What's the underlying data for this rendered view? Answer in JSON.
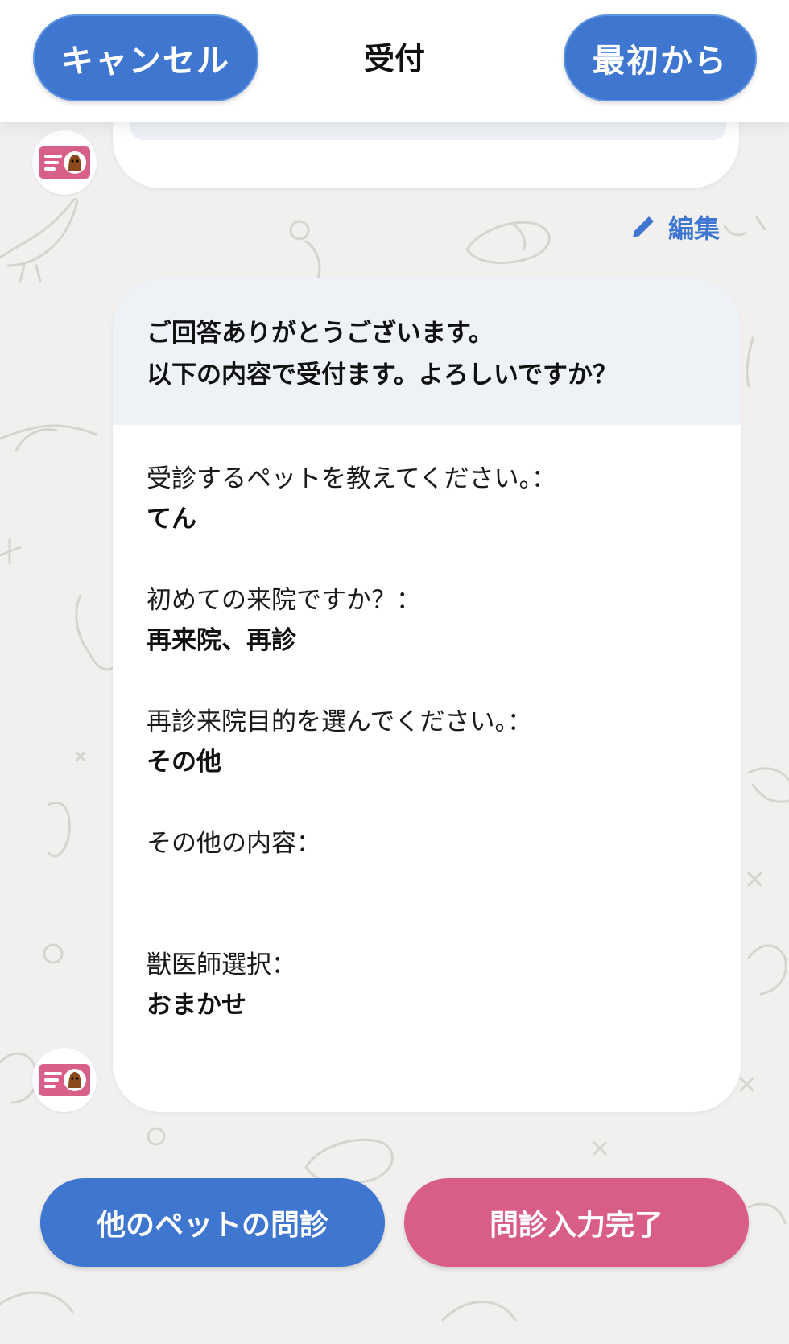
{
  "header": {
    "cancel_label": "キャンセル",
    "title": "受付",
    "restart_label": "最初から"
  },
  "edit_label": "編集",
  "confirmation": {
    "line1": "ご回答ありがとうございます。",
    "line2": "以下の内容で受付ます。よろしいですか？",
    "items": [
      {
        "question": "受診するペットを教えてください。：",
        "answer": "てん"
      },
      {
        "question": "初めての来院ですか？：",
        "answer": "再来院、再診"
      },
      {
        "question": "再診来院目的を選んでください。：",
        "answer": "その他"
      },
      {
        "question": "その他の内容：",
        "answer": ""
      },
      {
        "question": "獣医師選択：",
        "answer": "おまかせ"
      }
    ]
  },
  "footer": {
    "other_pet_label": "他のペットの問診",
    "complete_label": "問診入力完了"
  },
  "colors": {
    "primary_blue": "#3f76cf",
    "accent_pink": "#d95e86",
    "background": "#f1f0ee",
    "bubble_header": "#eef2f7"
  }
}
